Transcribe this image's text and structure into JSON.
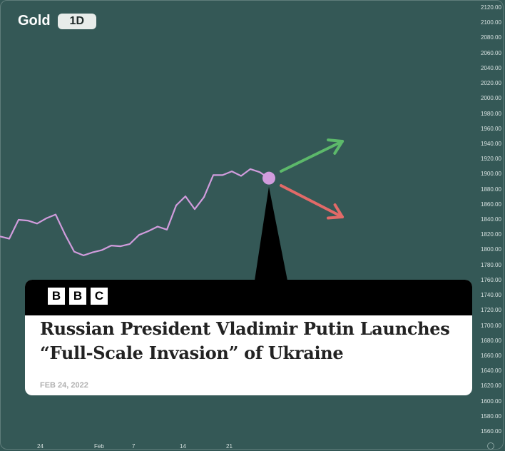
{
  "asset": "Gold",
  "timeframe": "1D",
  "chart_data": {
    "type": "line",
    "x_tick_labels": [
      "24",
      "Feb",
      "7",
      "14",
      "21"
    ],
    "y_tick_labels": [
      "2120.00",
      "2100.00",
      "2080.00",
      "2060.00",
      "2040.00",
      "2020.00",
      "2000.00",
      "1980.00",
      "1960.00",
      "1940.00",
      "1920.00",
      "1900.00",
      "1880.00",
      "1860.00",
      "1840.00",
      "1820.00",
      "1800.00",
      "1780.00",
      "1760.00",
      "1740.00",
      "1720.00",
      "1700.00",
      "1680.00",
      "1660.00",
      "1640.00",
      "1620.00",
      "1600.00",
      "1580.00",
      "1560.00"
    ],
    "ylim": [
      1550,
      2126
    ],
    "series": [
      {
        "values": [
          1818,
          1815,
          1840,
          1839,
          1835,
          1842,
          1847,
          1821,
          1798,
          1793,
          1797,
          1800,
          1806,
          1805,
          1808,
          1820,
          1825,
          1831,
          1827,
          1859,
          1871,
          1854,
          1870,
          1899,
          1899,
          1904,
          1898,
          1907,
          1903,
          1895
        ]
      }
    ],
    "highlight_point": {
      "index": 29,
      "value": 1895
    },
    "color": "#d19cdd"
  },
  "arrows": {
    "up_color": "#5cb86a",
    "down_color": "#e26a68"
  },
  "news": {
    "source_letters": [
      "B",
      "B",
      "C"
    ],
    "headline": "Russian President Vladimir Putin Launches “Full-Scale Invasion” of Ukraine",
    "date": "FEB 24, 2022"
  }
}
